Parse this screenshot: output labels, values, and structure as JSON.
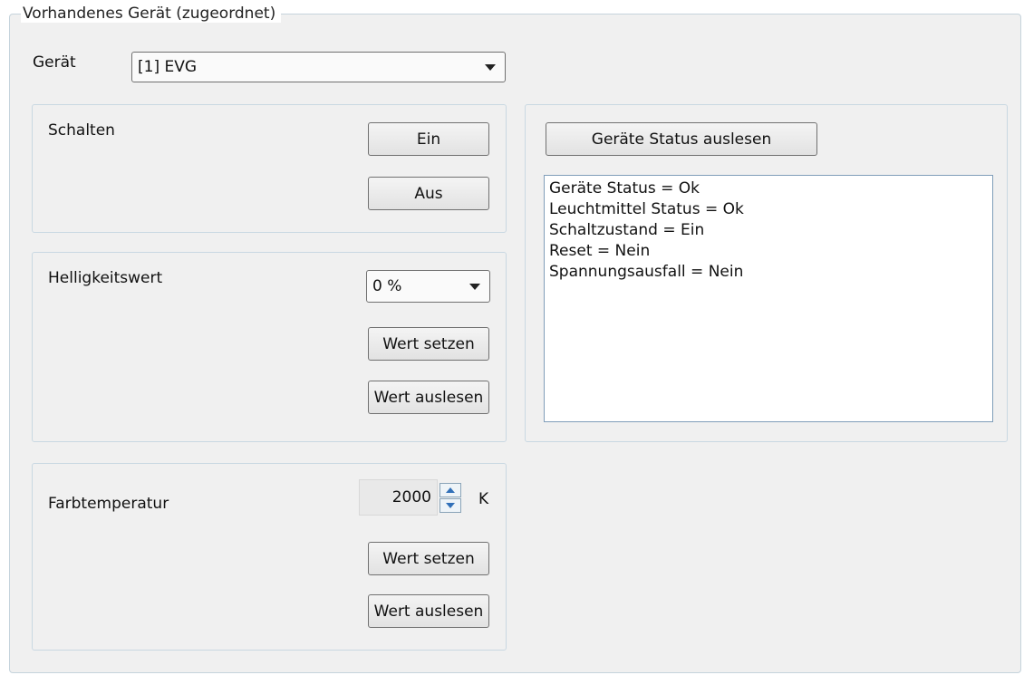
{
  "device_group": {
    "legend": "Vorhandenes Gerät (zugeordnet)",
    "device_label": "Gerät",
    "device_value": "[1] EVG"
  },
  "switch_group": {
    "label": "Schalten",
    "on_button": "Ein",
    "off_button": "Aus"
  },
  "brightness_group": {
    "label": "Helligkeitswert",
    "value": "0 %",
    "set_button": "Wert setzen",
    "read_button": "Wert auslesen"
  },
  "color_temp_group": {
    "label": "Farbtemperatur",
    "value": "2000",
    "unit": "K",
    "set_button": "Wert setzen",
    "read_button": "Wert auslesen"
  },
  "status_group": {
    "read_button": "Geräte Status auslesen",
    "lines": [
      "Geräte Status = Ok",
      "Leuchtmittel Status = Ok",
      "Schaltzustand = Ein",
      "Reset = Nein",
      "Spannungsausfall = Nein"
    ]
  }
}
